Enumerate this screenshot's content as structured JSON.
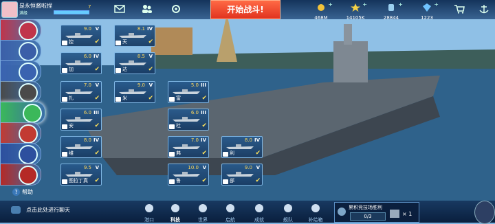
{
  "player": {
    "name": "是永恒酱啦捏",
    "level_label": "满级",
    "level": "7",
    "xp_fraction": 1.0
  },
  "top_icons": [
    "mail-icon",
    "friends-icon",
    "settings-icon"
  ],
  "start_battle_label": "开始战斗!",
  "resources": [
    {
      "name": "gold-coins-icon",
      "value": "468M"
    },
    {
      "name": "star-icon",
      "value": "14105K"
    },
    {
      "name": "fuel-icon",
      "value": "28844"
    },
    {
      "name": "gems-icon",
      "value": "1223"
    }
  ],
  "nations": [
    {
      "name": "nation-1",
      "color": "#c0344a"
    },
    {
      "name": "nation-usa",
      "color": "#3b5fa8"
    },
    {
      "name": "nation-3",
      "color": "#3a63b0"
    },
    {
      "name": "nation-germany",
      "color": "#4a4a4a"
    },
    {
      "name": "nation-5",
      "color": "#3bb85a"
    },
    {
      "name": "nation-6",
      "color": "#c23a32"
    },
    {
      "name": "nation-uk",
      "color": "#2d4f9e"
    },
    {
      "name": "nation-ussr",
      "color": "#b52a26"
    }
  ],
  "ship_cards": [
    {
      "name": "控",
      "level": "9.0",
      "tier": "V"
    },
    {
      "name": "天",
      "level": "8.1",
      "tier": "IV"
    },
    {
      "name": "加",
      "level": "6.0",
      "tier": "IV"
    },
    {
      "name": "达",
      "level": "8.5",
      "tier": "V"
    },
    {
      "name": "扎",
      "level": "7.0",
      "tier": "V"
    },
    {
      "name": "米",
      "level": "9.0",
      "tier": "V"
    },
    {
      "name": "富",
      "level": "5.0",
      "tier": "III"
    },
    {
      "name": "安",
      "level": "6.0",
      "tier": "III"
    },
    {
      "name": "杜",
      "level": "6.0",
      "tier": "III"
    },
    {
      "name": "维",
      "level": "8.0",
      "tier": "IV"
    },
    {
      "name": "弗",
      "level": "7.0",
      "tier": "IV"
    },
    {
      "name": "利",
      "level": "8.0",
      "tier": "IV"
    },
    {
      "name": "图拉丁真",
      "level": "9.5",
      "tier": "V"
    },
    {
      "name": "鲁",
      "level": "10.0",
      "tier": "V"
    },
    {
      "name": "部",
      "level": "9.0",
      "tier": "V"
    }
  ],
  "help_label": "帮助",
  "chat_prompt": "点击此处进行聊天",
  "nav": [
    {
      "label": "港口",
      "icon": "harbor-icon"
    },
    {
      "label": "科技",
      "icon": "tech-icon"
    },
    {
      "label": "世界",
      "icon": "world-icon"
    },
    {
      "label": "启航",
      "icon": "sail-icon"
    },
    {
      "label": "成就",
      "icon": "achievement-icon"
    },
    {
      "label": "舰队",
      "icon": "fleet-icon"
    },
    {
      "label": "补给箱",
      "icon": "supply-box-icon"
    }
  ],
  "nav_active": "科技",
  "task": {
    "title": "累积竞技场胜利",
    "progress": "0/3",
    "reward_count": "× 1"
  }
}
